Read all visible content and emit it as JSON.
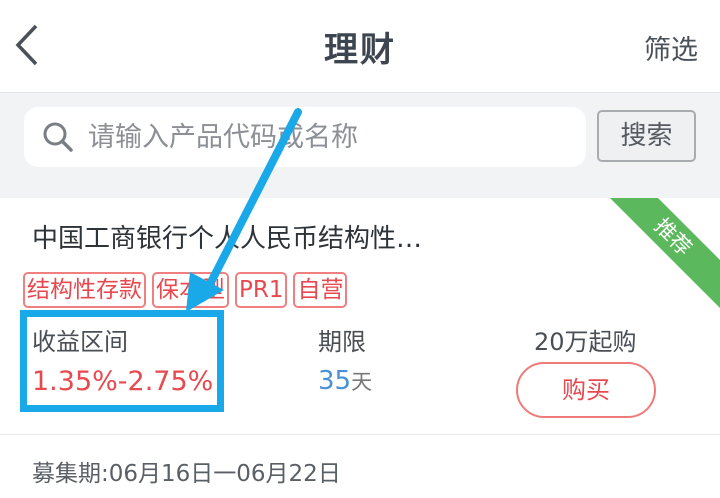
{
  "header": {
    "title": "理财",
    "filter_label": "筛选"
  },
  "search": {
    "placeholder": "请输入产品代码或名称",
    "button_label": "搜索"
  },
  "product": {
    "name": "中国工商银行个人人民币结构性…",
    "badge": "推荐",
    "tags": [
      "结构性存款",
      "保本型",
      "PR1",
      "自营"
    ],
    "yield_label": "收益区间",
    "yield_value": "1.35%-2.75%",
    "term_label": "期限",
    "term_value": "35",
    "term_unit": "天",
    "min_label": "20万起购",
    "buy_label": "购买",
    "period": "募集期:06月16日一06月22日"
  },
  "colors": {
    "accent_red": "#e8494f",
    "annotation_blue": "#19a9e8",
    "badge_green": "#5cb85c"
  }
}
